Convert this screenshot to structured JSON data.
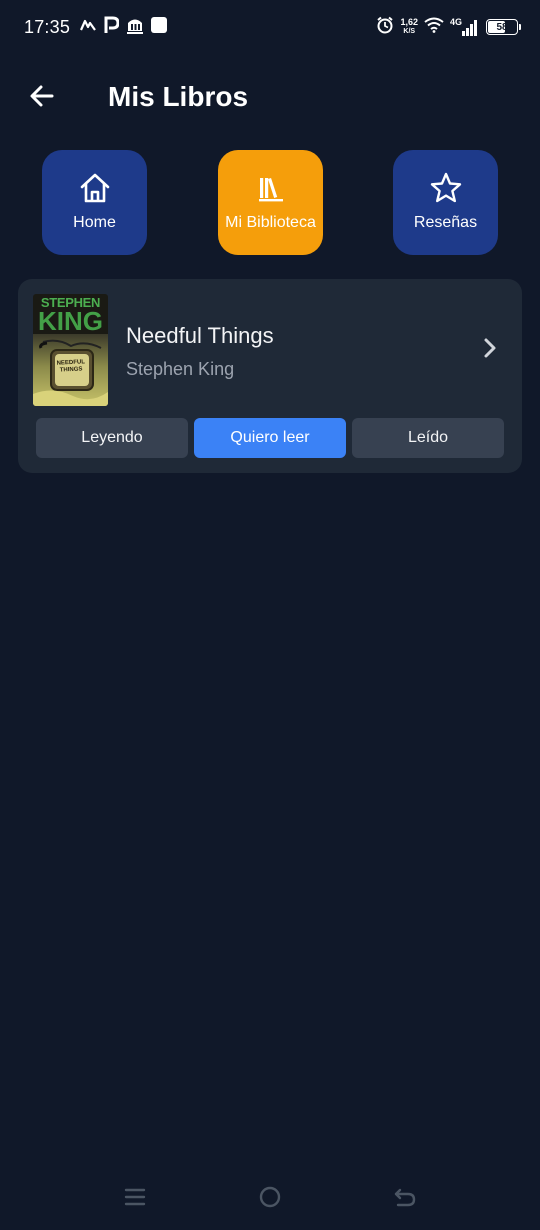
{
  "status_bar": {
    "time": "17:35",
    "net_speed_value": "1,62",
    "net_speed_unit": "K/S",
    "network": "4G",
    "battery": "58",
    "left_icons": [
      "signal-app-icon",
      "p-app-icon",
      "bank-app-icon",
      "square-app-icon"
    ],
    "right_icons": [
      "alarm-icon",
      "wifi-icon",
      "cell-signal-icon",
      "battery-icon"
    ]
  },
  "header": {
    "title": "Mis Libros",
    "back_icon": "arrow-left-icon"
  },
  "nav": {
    "home_label": "Home",
    "library_label": "Mi Biblioteca",
    "reviews_label": "Reseñas",
    "active": "library",
    "colors": {
      "inactive": "#1e3a8a",
      "active": "#f59e0b"
    }
  },
  "books": [
    {
      "title": "Needful Things",
      "author": "Stephen King",
      "cover": {
        "top_text": "STEPHEN",
        "big_text": "KING",
        "title_text": "NEEDFUL THINGS"
      },
      "status_options": [
        "Leyendo",
        "Quiero leer",
        "Leído"
      ],
      "selected_status": "Quiero leer"
    }
  ],
  "colors": {
    "background": "#101829",
    "card": "#1f2937",
    "accent": "#3b82f6",
    "secondary_text": "#9ca3af"
  }
}
